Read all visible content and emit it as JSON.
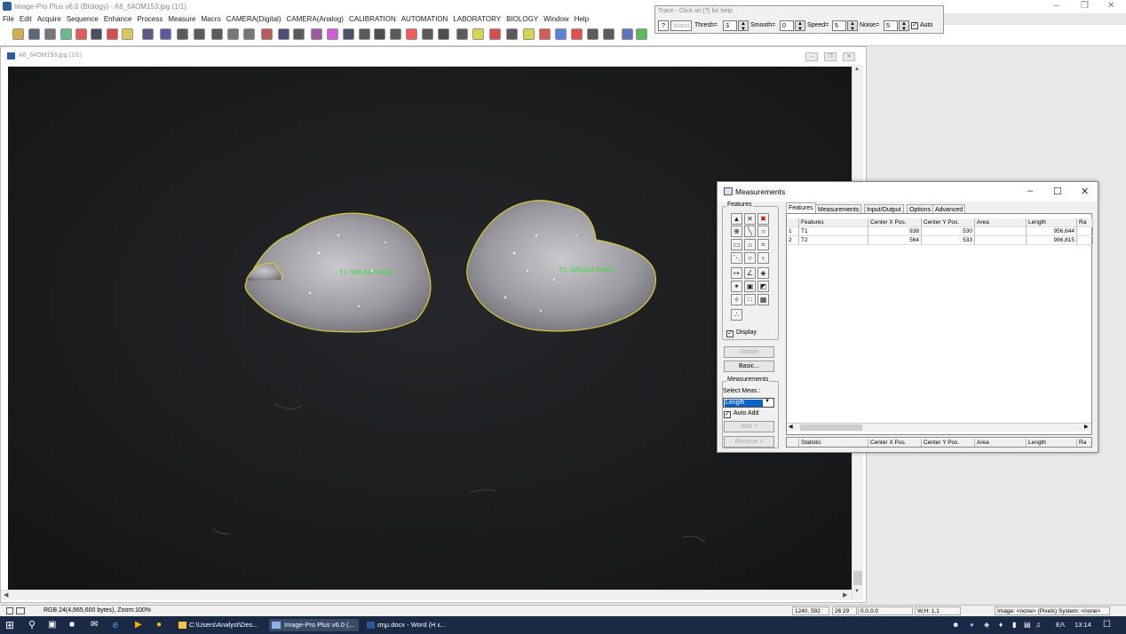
{
  "app": {
    "title": "Image-Pro Plus v6.0 (Biology) - A6_64OM153.jpg (1/1)"
  },
  "menu": [
    "File",
    "Edit",
    "Acquire",
    "Sequence",
    "Enhance",
    "Process",
    "Measure",
    "Macro",
    "CAMERA(Digital)",
    "CAMERA(Analog)",
    "CALIBRATION",
    "AUTOMATION",
    "LABORATORY",
    "BIOLOGY",
    "Window",
    "Help"
  ],
  "trace": {
    "title": "Trace - Click on [?] for help",
    "help_label": "?",
    "wand_label": "Wand",
    "thresh_label": "Thresh=",
    "thresh_value": "3",
    "smooth_label": "Smooth=",
    "smooth_value": "0",
    "speed_label": "Speed=",
    "speed_value": "5",
    "noise_label": "Noise=",
    "noise_value": "5",
    "auto_label": "Auto",
    "auto_checked": true
  },
  "image_window": {
    "title": "A6_64OM153.jpg (1/1)",
    "labels": [
      "T1: 956,644 Pixels",
      "T2: 986,815 Pixels"
    ],
    "outline_color": "#d8c83a",
    "label_color": "#34e034"
  },
  "measurements": {
    "title": "Measurements",
    "features_group": "Features",
    "tools": [
      "pointer-icon",
      "cross-icon",
      "delete-icon",
      "crosshair-icon",
      "line-icon",
      "circle-icon",
      "rect-icon",
      "polygon-icon",
      "trace-icon",
      "polyline-icon",
      "ellipse-icon",
      "arc-icon",
      "distance-icon",
      "angle-icon",
      "auto-trace-icon",
      "wand-icon",
      "count-icon",
      "fill-icon",
      "sparkle-icon",
      "dots-icon",
      "grid-icon",
      "calibrate-icon"
    ],
    "display_label": "Display",
    "display_checked": true,
    "update_label": "Update",
    "basic_label": "Basic...",
    "meas_group": "Measurements",
    "select_meas_label": "Select Meas.:",
    "select_meas_value": "Length",
    "auto_add_label": "Auto Add",
    "auto_add_checked": true,
    "add_label": "Add >",
    "remove_label": "Remove <",
    "tabs": [
      "Features",
      "Measurements",
      "Input/Output",
      "Options",
      "Advanced Opt."
    ],
    "columns": [
      "",
      "Features",
      "Center X Pos.",
      "Center Y Pos.",
      "Area",
      "Length",
      "Ra"
    ],
    "rows": [
      [
        "1",
        "T1",
        "938",
        "530",
        "",
        "956,644",
        ""
      ],
      [
        "2",
        "T2",
        "564",
        "533",
        "",
        "986,815",
        ""
      ]
    ],
    "stat_columns": [
      "",
      "Statistic",
      "Center X Pos.",
      "Center Y Pos.",
      "Area",
      "Length",
      "Ra"
    ]
  },
  "status": {
    "image_info": "RGB 24(4,665,600 bytes), Zoom:100%",
    "cursor": "1240, 592",
    "pixel": "26 29",
    "value": "0.0.0.0",
    "wh": "W,H: 1,1",
    "calib": "Image: <none> (Pixels) System: <none>"
  },
  "taskbar": {
    "items": [
      "C:\\Users\\Analyst\\Des...",
      "Image-Pro Plus v6.0 (...",
      "σημ.docx - Word (H ε..."
    ],
    "lang": "ΕΛ",
    "time": "13:14"
  }
}
